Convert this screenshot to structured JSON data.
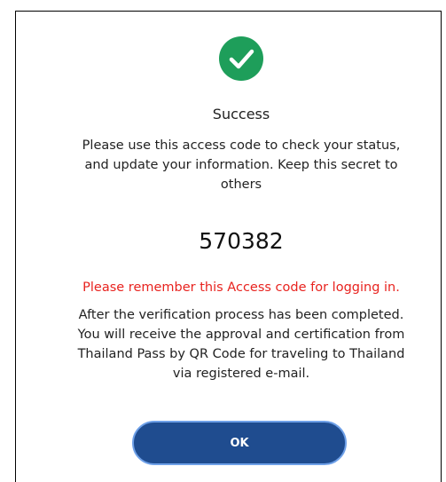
{
  "dialog": {
    "icon": "check-circle-icon",
    "title": "Success",
    "instruction_lines": [
      "Please use this access code to check your status,",
      "and update your information. Keep this secret to",
      "others"
    ],
    "access_code": "570382",
    "warning": "Please remember this Access code for logging in.",
    "info_lines": [
      "After the verification process has been completed.",
      "You will receive the approval and certification from",
      "Thailand Pass by QR Code for traveling to Thailand",
      "via registered e-mail."
    ],
    "ok_label": "OK"
  },
  "colors": {
    "success_green": "#1e9e5a",
    "warning_red": "#e8231f",
    "button_blue": "#1f4c8f",
    "button_border": "#6ea0e8"
  }
}
